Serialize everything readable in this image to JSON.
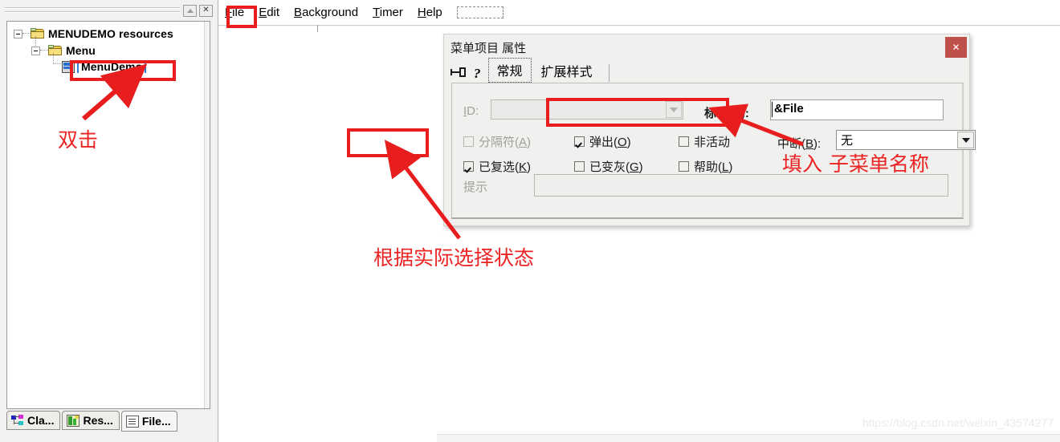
{
  "left_pane": {
    "minimize_icon": "triangle-up-icon",
    "close_icon": "close-icon",
    "tree": [
      {
        "label": "MENUDEMO resources",
        "icon": "folder-icon",
        "expander": "minus"
      },
      {
        "label": "Menu",
        "icon": "folder-icon",
        "expander": "minus"
      },
      {
        "label": "MenuDemo",
        "icon": "menu-resource-icon",
        "expander": "none",
        "selected": true
      }
    ],
    "tabs": [
      {
        "label": "Cla...",
        "icon": "class-view-icon",
        "active": false
      },
      {
        "label": "Res...",
        "icon": "resource-view-icon",
        "active": false
      },
      {
        "label": "File...",
        "icon": "file-view-icon",
        "active": true
      }
    ]
  },
  "menubar": {
    "items": [
      {
        "label": "File",
        "mnemonic": "F"
      },
      {
        "label": "Edit",
        "mnemonic": "E"
      },
      {
        "label": "Background",
        "mnemonic": "B"
      },
      {
        "label": "Timer",
        "mnemonic": "T"
      },
      {
        "label": "Help",
        "mnemonic": "H"
      }
    ],
    "new_item_placeholder": ""
  },
  "dialog": {
    "title": "菜单项目 属性",
    "close_label": "✕",
    "pin_icon": "pushpin-icon",
    "help_icon": "question-mark-icon",
    "tabs": [
      {
        "label": "常规",
        "active": true
      },
      {
        "label": "扩展样式",
        "active": false
      }
    ],
    "fields": {
      "id_label": "ID:",
      "id_value": "",
      "caption_label_prefix": "标明",
      "caption_label_mnemonic": "C",
      "caption_label_suffix": ":",
      "caption_value": "&File",
      "break_label_prefix": "中断",
      "break_label_mnemonic": "B",
      "break_label_suffix": ":",
      "break_value": "无",
      "tip_label": "提示",
      "tip_value": ""
    },
    "checkboxes": [
      {
        "label_prefix": "分隔符",
        "mnemonic": "A",
        "checked": false,
        "disabled": true
      },
      {
        "label_prefix": "弹出",
        "mnemonic": "O",
        "checked": true,
        "disabled": false
      },
      {
        "label_prefix": "非活动",
        "mnemonic": "",
        "checked": false,
        "disabled": false
      },
      {
        "label_prefix": "已复选",
        "mnemonic": "K",
        "checked": true,
        "disabled": false
      },
      {
        "label_prefix": "已变灰",
        "mnemonic": "G",
        "checked": false,
        "disabled": false
      },
      {
        "label_prefix": "帮助",
        "mnemonic": "L",
        "checked": false,
        "disabled": false
      }
    ]
  },
  "annotations": {
    "color": "#ec2323",
    "double_click": "双击",
    "fill_submenu_name": "填入 子菜单名称",
    "select_state_by_actual": "根据实际选择状态"
  },
  "watermark": "https://blog.csdn.net/weixin_43574277"
}
